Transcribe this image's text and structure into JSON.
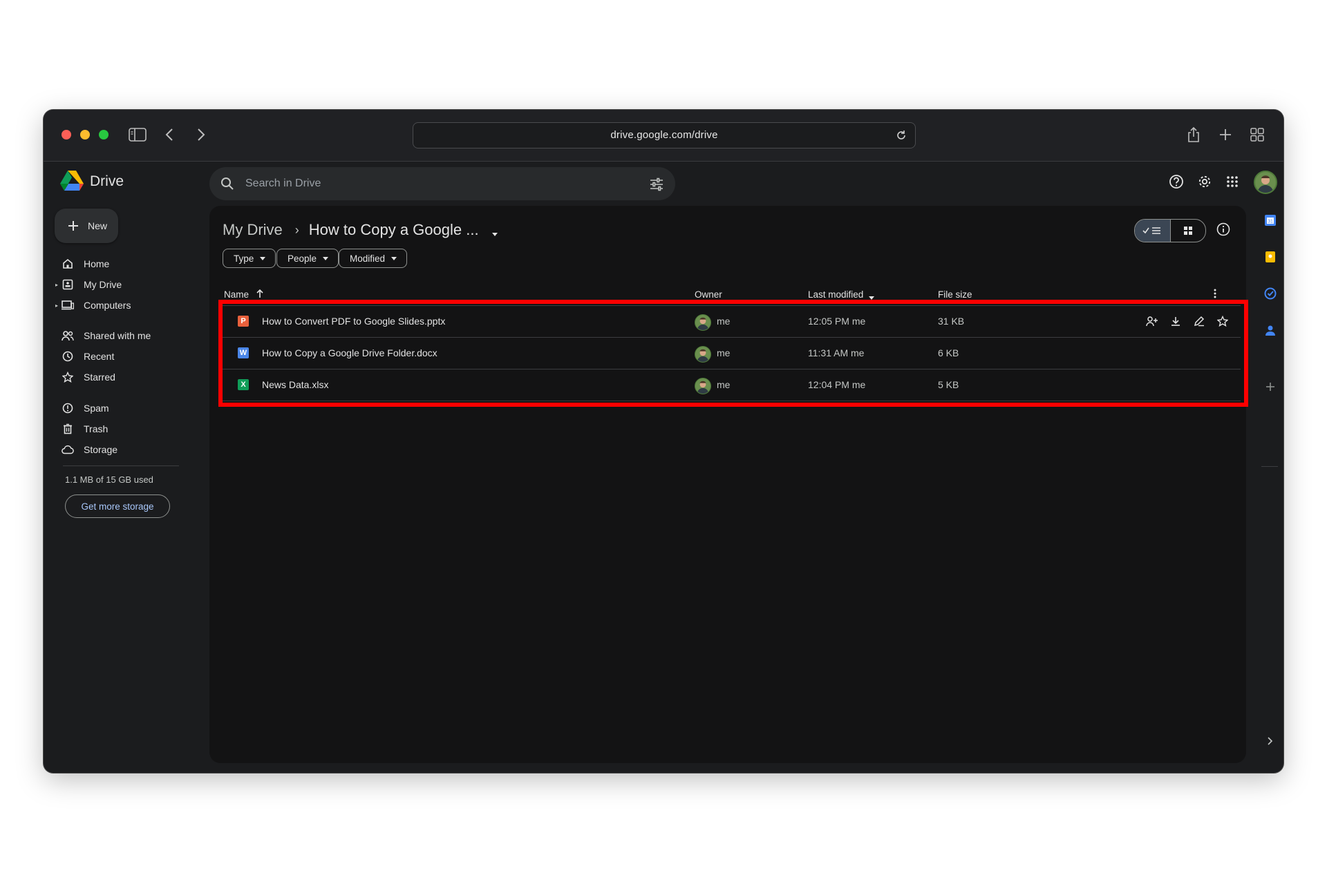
{
  "browser": {
    "url": "drive.google.com/drive"
  },
  "app": {
    "name": "Drive"
  },
  "search": {
    "placeholder": "Search in Drive"
  },
  "sidebar": {
    "new_label": "New",
    "items": [
      {
        "label": "Home",
        "icon": "home-icon"
      },
      {
        "label": "My Drive",
        "icon": "my-drive-icon"
      },
      {
        "label": "Computers",
        "icon": "computers-icon"
      },
      {
        "label": "Shared with me",
        "icon": "shared-icon"
      },
      {
        "label": "Recent",
        "icon": "clock-icon"
      },
      {
        "label": "Starred",
        "icon": "star-icon"
      },
      {
        "label": "Spam",
        "icon": "spam-icon"
      },
      {
        "label": "Trash",
        "icon": "trash-icon"
      },
      {
        "label": "Storage",
        "icon": "cloud-icon"
      }
    ],
    "storage_text": "1.1 MB of 15 GB used",
    "storage_button": "Get more storage"
  },
  "breadcrumb": {
    "root": "My Drive",
    "separator": "›",
    "current": "How to Copy a Google ..."
  },
  "filters": [
    {
      "label": "Type"
    },
    {
      "label": "People"
    },
    {
      "label": "Modified"
    }
  ],
  "table": {
    "headers": {
      "name": "Name",
      "owner": "Owner",
      "last_modified": "Last modified",
      "file_size": "File size"
    },
    "rows": [
      {
        "type_letter": "P",
        "type_color": "#e8603c",
        "name": "How to Convert PDF to Google Slides.pptx",
        "owner": "me",
        "modified": "12:05 PM me",
        "size": "31 KB"
      },
      {
        "type_letter": "W",
        "type_color": "#4a86e8",
        "name": "How to Copy a Google Drive Folder.docx",
        "owner": "me",
        "modified": "11:31 AM me",
        "size": "6 KB"
      },
      {
        "type_letter": "X",
        "type_color": "#0f9d58",
        "name": "News Data.xlsx",
        "owner": "me",
        "modified": "12:04 PM me",
        "size": "5 KB"
      }
    ]
  },
  "colors": {
    "highlight": "#ff0000",
    "link": "#a8c7fa",
    "window_bg": "#1b1c1e"
  }
}
